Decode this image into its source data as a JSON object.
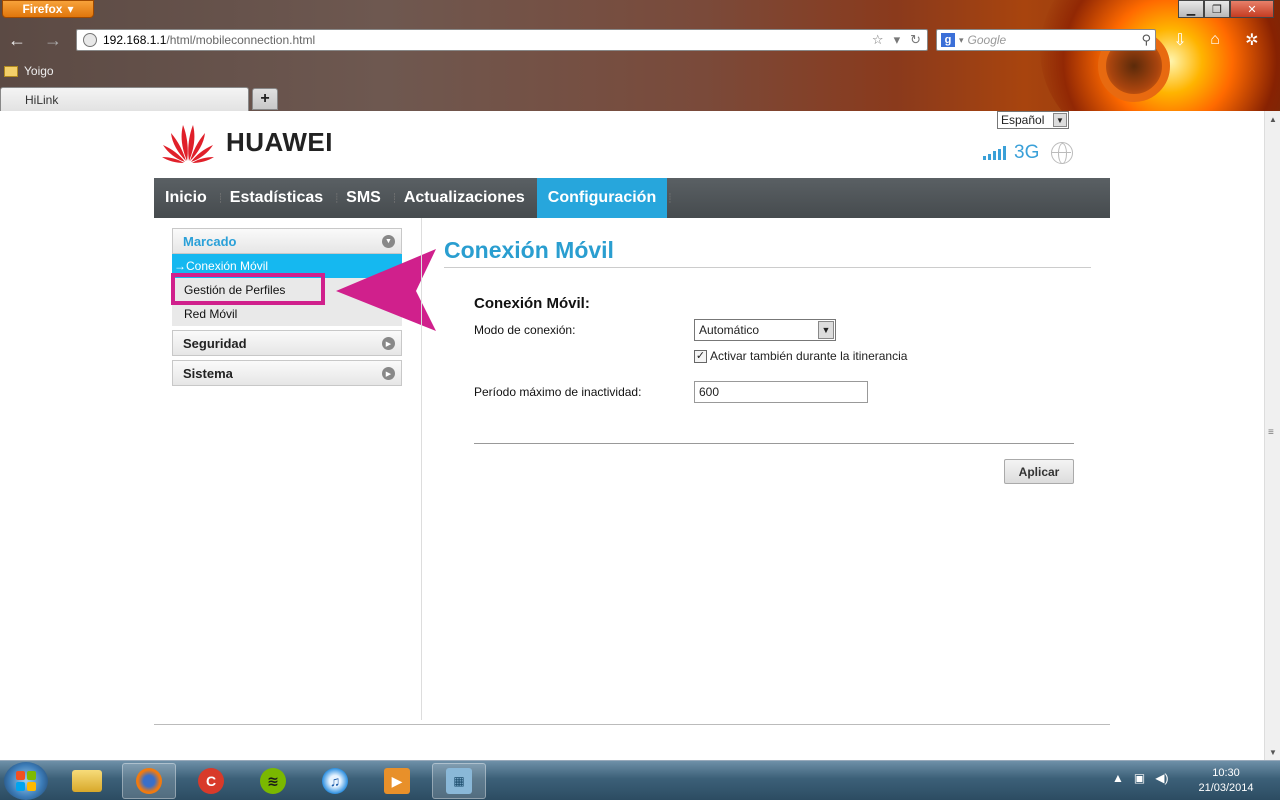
{
  "browser": {
    "app_button": "Firefox",
    "url_host": "192.168.1.1",
    "url_path": "/html/mobileconnection.html",
    "search_placeholder": "Google",
    "bookmark": "Yoigo",
    "tab_title": "HiLink"
  },
  "header": {
    "language": "Español",
    "brand": "HUAWEI",
    "network_type": "3G",
    "signal_bars": 5
  },
  "nav": {
    "items": [
      "Inicio",
      "Estadísticas",
      "SMS",
      "Actualizaciones",
      "Configuración"
    ],
    "active": "Configuración"
  },
  "sidebar": {
    "marcado": "Marcado",
    "marcado_items": [
      "→Conexión Móvil",
      "Gestión de Perfiles",
      "Red Móvil"
    ],
    "seguridad": "Seguridad",
    "sistema": "Sistema"
  },
  "main": {
    "title": "Conexión Móvil",
    "form_heading": "Conexión Móvil:",
    "mode_label": "Modo de conexión:",
    "mode_value": "Automático",
    "roaming_label": "Activar también durante la itinerancia",
    "roaming_checked": true,
    "idle_label": "Período máximo de inactividad:",
    "idle_value": "600",
    "apply": "Aplicar"
  },
  "taskbar": {
    "time": "10:30",
    "date": "21/03/2014"
  },
  "colors": {
    "accent": "#27a6dc",
    "annotation": "#d0208c",
    "huawei_red": "#e0202a"
  }
}
